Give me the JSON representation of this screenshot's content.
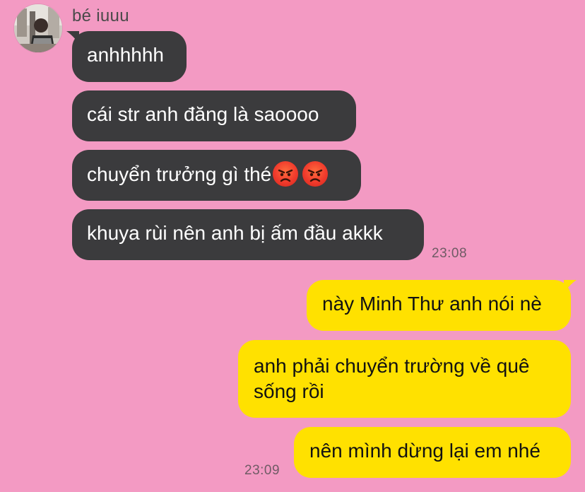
{
  "contact": {
    "name": "bé iuuu"
  },
  "incoming": [
    {
      "text": "anhhhhh"
    },
    {
      "text": "cái str anh đăng là saoooo"
    },
    {
      "text": "chuyển trưởng gì thé",
      "emoji": [
        "angry-face-emoji",
        "angry-face-emoji"
      ]
    },
    {
      "text": "khuya rùi nên anh bị ấm đầu akkk"
    }
  ],
  "incoming_time": "23:08",
  "outgoing": [
    {
      "text": "này Minh Thư anh nói nè"
    },
    {
      "line1": "anh phải chuyển trường về quê",
      "line2": "sống rồi"
    },
    {
      "text": "nên mình dừng lại em nhé"
    }
  ],
  "outgoing_time": "23:09",
  "colors": {
    "background": "#f39ac3",
    "incoming_bubble": "#3b3b3d",
    "outgoing_bubble": "#ffe100",
    "incoming_text": "#ffffff",
    "outgoing_text": "#121212",
    "emoji": "#f03a2c"
  }
}
